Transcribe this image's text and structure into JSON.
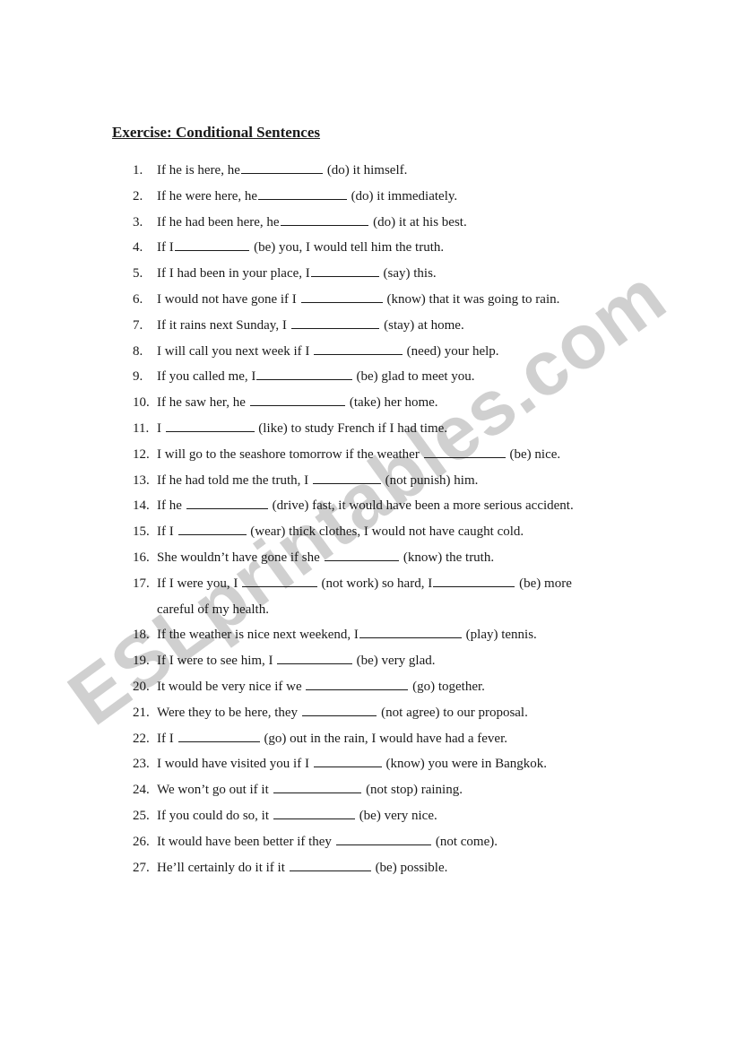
{
  "watermark": "ESLprintables.com",
  "title": "Exercise: Conditional Sentences",
  "items": [
    {
      "num": "1.",
      "before": "If he is here, he",
      "blank_chars": 12,
      "after": " (do) it himself."
    },
    {
      "num": "2.",
      "before": "If he were here, he",
      "blank_chars": 13,
      "after": " (do) it immediately."
    },
    {
      "num": "3.",
      "before": "If he had been here, he",
      "blank_chars": 13,
      "after": " (do) it at his best."
    },
    {
      "num": "4.",
      "before": "If I",
      "blank_chars": 11,
      "after": " (be) you, I would tell him the truth."
    },
    {
      "num": "5.",
      "before": "If I had been in your place, I",
      "blank_chars": 10,
      "after": " (say) this."
    },
    {
      "num": "6.",
      "before": "I would not have gone if I ",
      "blank_chars": 12,
      "after": " (know) that it was going to rain."
    },
    {
      "num": "7.",
      "before": "If it rains next Sunday, I ",
      "blank_chars": 13,
      "after": " (stay) at home."
    },
    {
      "num": "8.",
      "before": "I will call you next week if I ",
      "blank_chars": 13,
      "after": " (need) your help."
    },
    {
      "num": "9.",
      "before": "If you called me, I",
      "blank_chars": 14,
      "after": " (be) glad to meet you."
    },
    {
      "num": "10.",
      "before": "If he saw her, he ",
      "blank_chars": 14,
      "after": " (take) her home."
    },
    {
      "num": "11.",
      "before": "I ",
      "blank_chars": 13,
      "after": " (like) to study French if I had time."
    },
    {
      "num": "12.",
      "before": "I will go to the seashore tomorrow if the weather ",
      "blank_chars": 12,
      "after": " (be) nice."
    },
    {
      "num": "13.",
      "before": "If he had told me the truth, I ",
      "blank_chars": 10,
      "after": " (not punish) him."
    },
    {
      "num": "14.",
      "before": "If he ",
      "blank_chars": 12,
      "after": " (drive) fast, it would have been a more serious accident."
    },
    {
      "num": "15.",
      "before": "If I ",
      "blank_chars": 10,
      "after": " (wear) thick clothes, I would not have caught cold."
    },
    {
      "num": "16.",
      "before": "She wouldn’t have gone if she ",
      "blank_chars": 11,
      "after": " (know) the truth."
    },
    {
      "num": "17.",
      "before": "If I were you, I ",
      "blank_chars": 11,
      "after": " (not work) so hard, I",
      "blank2_chars": 12,
      "after2": " (be) more",
      "continuation": "careful of my health."
    },
    {
      "num": "18.",
      "before": "If the weather is nice next weekend, I",
      "blank_chars": 15,
      "after": " (play) tennis."
    },
    {
      "num": "19.",
      "before": "If I were to see him, I ",
      "blank_chars": 11,
      "after": " (be) very glad."
    },
    {
      "num": "20.",
      "before": "It would be very nice if we ",
      "blank_chars": 15,
      "after": " (go) together."
    },
    {
      "num": "21.",
      "before": "Were they to be here, they ",
      "blank_chars": 11,
      "after": " (not agree) to our proposal."
    },
    {
      "num": "22.",
      "before": "If I ",
      "blank_chars": 12,
      "after": " (go) out in the rain, I would have had a fever."
    },
    {
      "num": "23.",
      "before": "I would have visited you if I ",
      "blank_chars": 10,
      "after": " (know) you were in Bangkok."
    },
    {
      "num": "24.",
      "before": "We won’t go out if it ",
      "blank_chars": 13,
      "after": " (not stop) raining."
    },
    {
      "num": "25.",
      "before": "If you could do so, it ",
      "blank_chars": 12,
      "after": " (be) very nice."
    },
    {
      "num": "26.",
      "before": "It would have been better if they ",
      "blank_chars": 14,
      "after": " (not come)."
    },
    {
      "num": "27.",
      "before": "He’ll certainly do it if it ",
      "blank_chars": 12,
      "after": " (be) possible."
    }
  ]
}
